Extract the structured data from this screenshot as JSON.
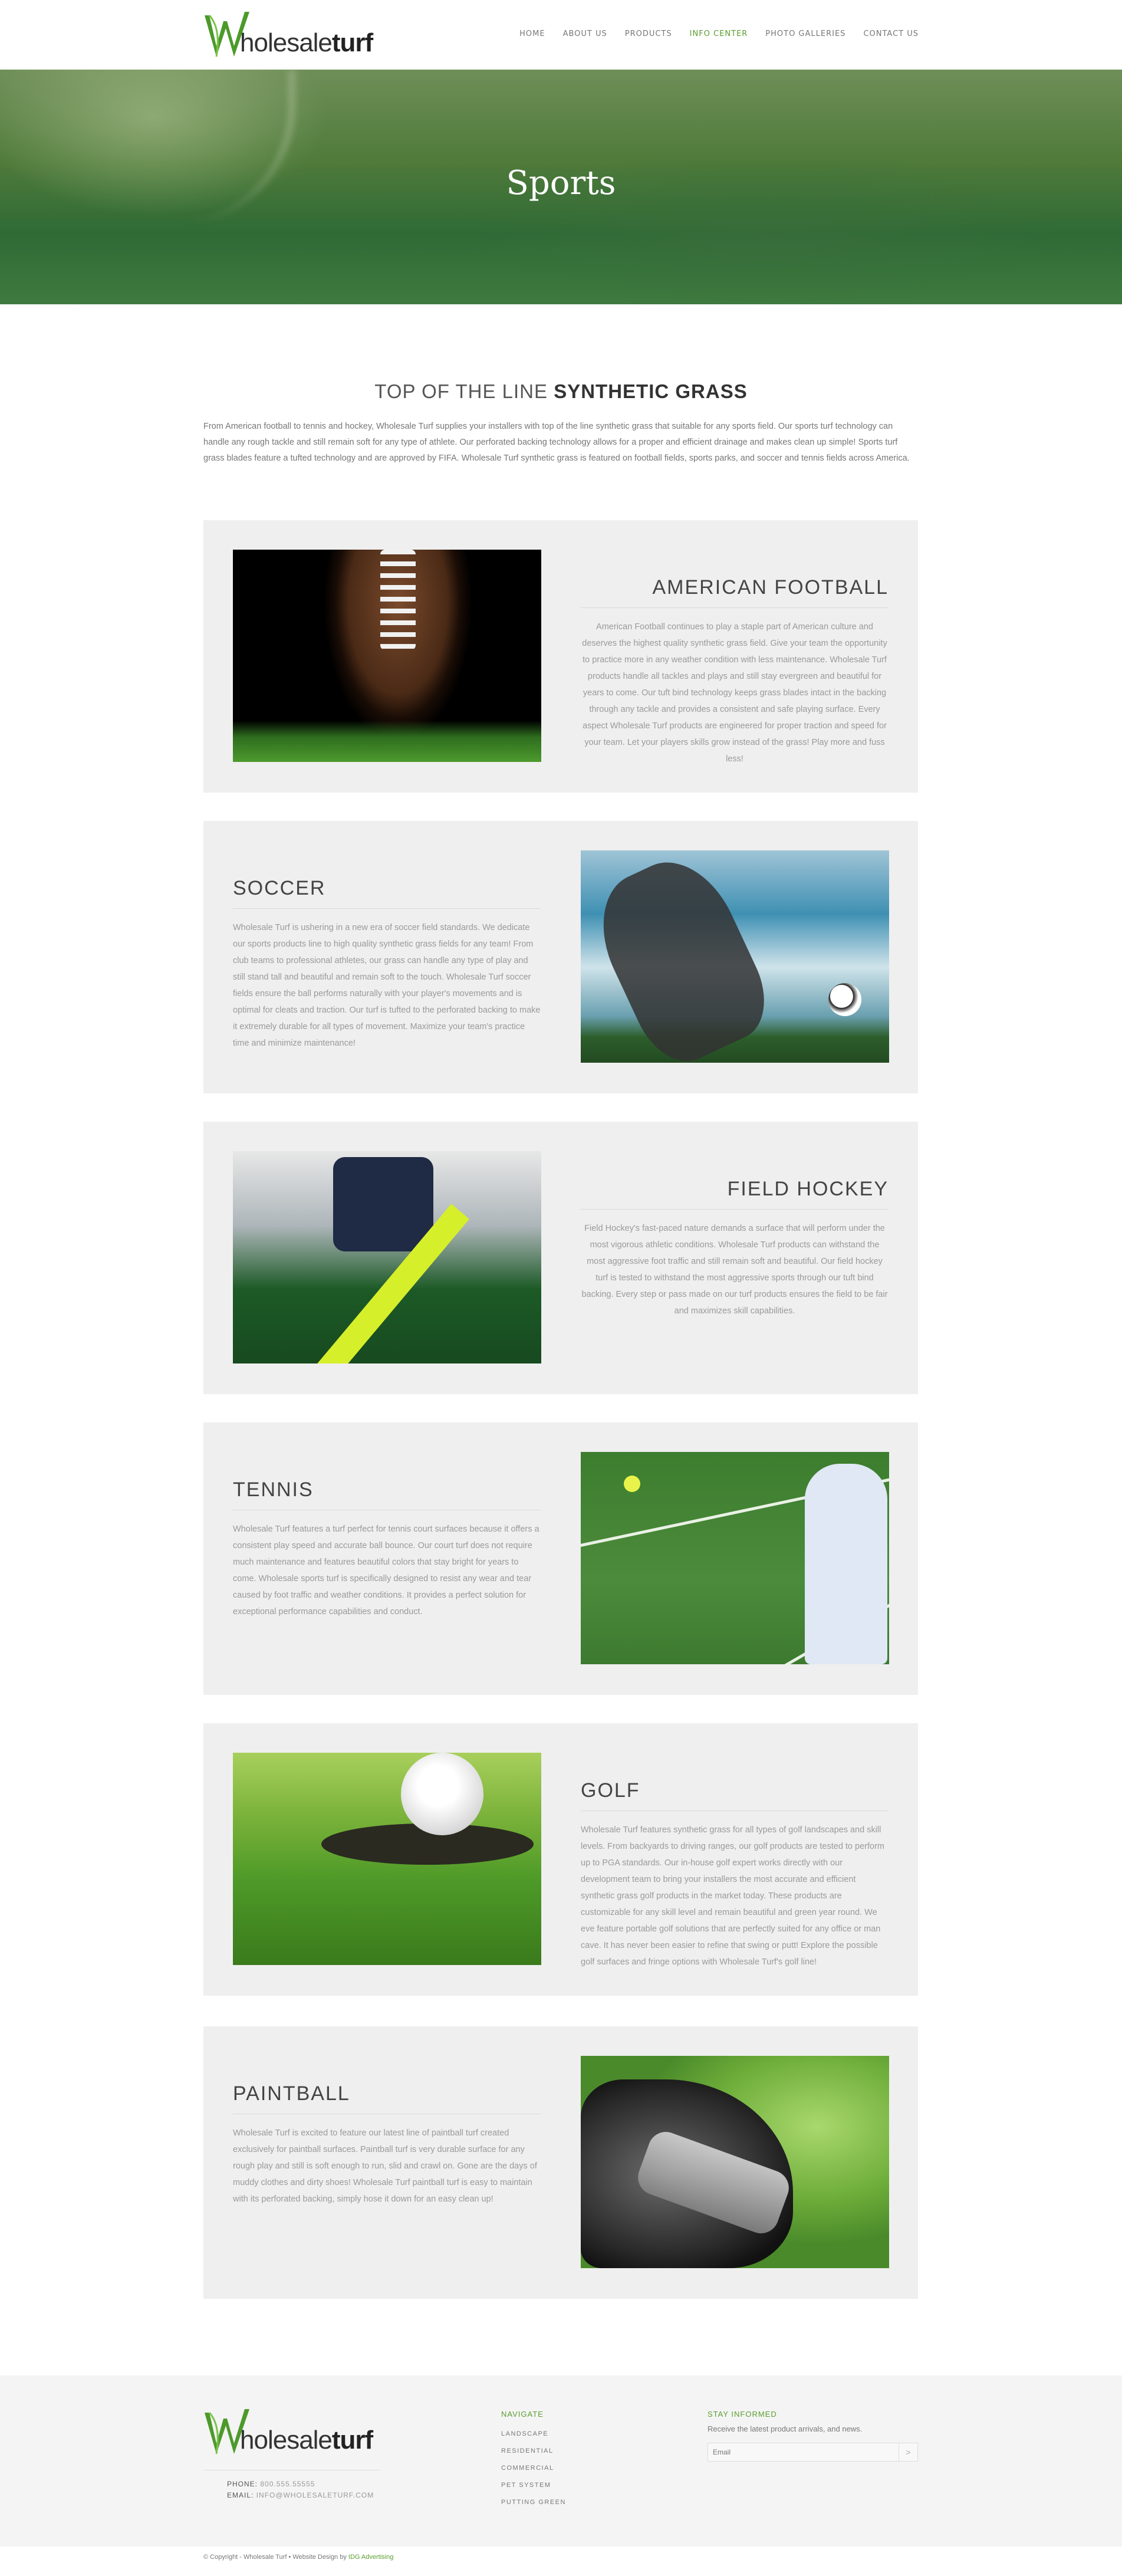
{
  "brand": {
    "logo_letter": "W",
    "logo_part1": "holesale",
    "logo_part2": "turf",
    "accent": "#5a9e2f"
  },
  "nav": {
    "items": [
      "HOME",
      "ABOUT US",
      "PRODUCTS",
      "INFO CENTER",
      "PHOTO GALLERIES",
      "CONTACT US"
    ],
    "active": "INFO CENTER"
  },
  "hero": {
    "title": "Sports"
  },
  "intro": {
    "title_light": "TOP OF THE LINE ",
    "title_bold": "SYNTHETIC GRASS",
    "text": "From American football to tennis and hockey, Wholesale Turf supplies your installers with top of the line synthetic grass that suitable for any sports field. Our sports turf technology can handle any rough tackle and still remain soft for any type of athlete. Our perforated backing technology allows for a proper and efficient drainage and makes clean up simple! Sports turf grass blades feature a tufted technology and are approved by FIFA. Wholesale Turf synthetic grass is featured on football fields, sports parks, and soccer and tennis fields across America."
  },
  "sports": [
    {
      "title": "AMERICAN FOOTBALL",
      "text": "American Football continues to play a staple part of American culture and deserves the highest quality synthetic grass field. Give your team the opportunity to practice more in any weather condition with less maintenance. Wholesale Turf products handle all tackles and plays and still stay evergreen and beautiful for years to come. Our tuft bind technology keeps grass blades intact in the backing through any tackle and provides a consistent and safe playing surface. Every aspect Wholesale Turf products are engineered for proper traction and speed for your team. Let your players skills grow instead of the grass! Play more and fuss less!",
      "image": "football-on-grass"
    },
    {
      "title": "SOCCER",
      "text": "Wholesale Turf is ushering in a new era of soccer field standards. We dedicate our sports products line to high quality synthetic grass fields for any team! From club teams to professional athletes, our grass can handle any type of play and still stand tall and beautiful and remain soft to the touch. Wholesale Turf soccer fields ensure the ball performs naturally with your player's movements and is optimal for cleats and traction. Our turf is tufted to the perforated backing to make it extremely durable for all types of movement. Maximize your team's practice time and minimize maintenance!",
      "image": "soccer-player-kicking"
    },
    {
      "title": "FIELD HOCKEY",
      "text": "Field Hockey's fast-paced nature demands a surface that will perform under the most vigorous athletic conditions. Wholesale Turf products can withstand the most aggressive foot traffic and still remain soft and beautiful. Our field hockey turf is tested to withstand the most aggressive sports through our tuft bind backing. Every step or pass made on our turf products ensures the field to be fair and maximizes skill capabilities.",
      "image": "field-hockey-player"
    },
    {
      "title": "TENNIS",
      "text": "Wholesale Turf features a turf perfect for tennis court surfaces because it offers a consistent play speed and accurate ball bounce. Our court turf does not require much maintenance and features beautiful colors that stay bright for years to come. Wholesale sports turf is specifically designed to resist any wear and tear caused by foot traffic and weather conditions. It provides a perfect solution for exceptional performance capabilities and conduct.",
      "image": "tennis-player"
    },
    {
      "title": "GOLF",
      "text": "Wholesale Turf features synthetic grass for all types of golf landscapes and skill levels. From backyards to driving ranges, our golf products are tested to perform up to PGA standards. Our in-house golf expert works directly with our development team to bring your installers the most accurate and efficient synthetic grass golf products in the market today. These products are customizable for any skill level and remain beautiful and green year round. We eve feature portable golf solutions that are perfectly suited for any office or man cave. It has never been easier to refine that swing or putt! Explore the possible golf surfaces and fringe options with Wholesale Turf's golf line!",
      "image": "golf-ball-near-hole"
    },
    {
      "title": "PAINTBALL",
      "text": "Wholesale Turf is excited to feature our latest line of paintball turf created exclusively for paintball surfaces. Paintball turf is very durable surface for any rough play and still is soft enough to run, slid and crawl on. Gone are the days of muddy clothes and dirty shoes! Wholesale Turf paintball turf is easy to maintain with its perforated backing, simply hose it down for an easy clean up!",
      "image": "paintball-mask"
    }
  ],
  "footer": {
    "phone_label": "PHONE:",
    "phone": "800.555.55555",
    "email_label": "EMAIL:",
    "email": "INFO@WHOLESALETURF.COM",
    "navigate_title": "NAVIGATE",
    "navigate_items": [
      "LANDSCAPE",
      "RESIDENTIAL",
      "COMMERCIAL",
      "PET SYSTEM",
      "PUTTING GREEN"
    ],
    "stay_title": "STAY INFORMED",
    "stay_text": "Receive the latest product arrivals, and news.",
    "email_placeholder": "Email",
    "send_icon": ">",
    "copyright_text": "© Copyright - Wholesale Turf • Website Design by ",
    "copyright_link": "IDG Advertising"
  }
}
